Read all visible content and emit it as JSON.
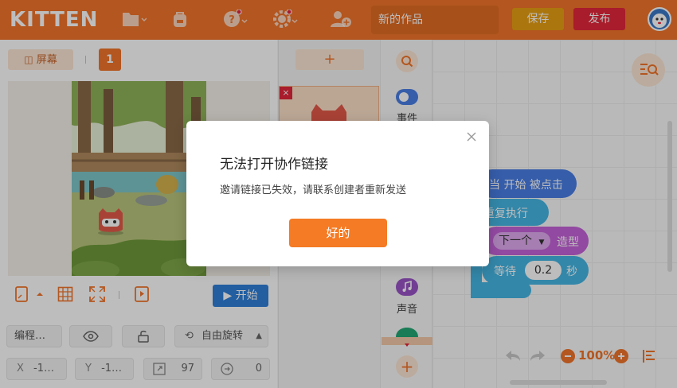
{
  "app": {
    "logo": "KITTEN"
  },
  "toolbar": {
    "file_icon": "folder-icon",
    "backpack_icon": "backpack-icon",
    "help_icon": "help-icon",
    "settings_icon": "gear-icon",
    "collab_icon": "add-user-icon",
    "title_placeholder": "新的作品",
    "save_label": "保存",
    "publish_label": "发布",
    "accent": "#f2752a",
    "save_color": "#e8a013",
    "publish_color": "#e5263a"
  },
  "stage": {
    "screen_label": "屏幕",
    "page_number": "1",
    "start_label": "开始",
    "start_color": "#2f7fd8"
  },
  "properties": {
    "name": "编程…",
    "rotation_mode": "自由旋转",
    "x_label": "X",
    "x_value": "-1…",
    "y_label": "Y",
    "y_value": "-1…",
    "size_value": "97",
    "direction_value": "0"
  },
  "sprites": {
    "add_label": "+",
    "delete_label": "×"
  },
  "categories": {
    "items": [
      {
        "label": "事件",
        "color": "#4a7ee5",
        "icon": "toggle-icon"
      },
      {
        "label": "声音",
        "color": "#9a54c8",
        "icon": "music-note-icon"
      }
    ],
    "add_label": "+"
  },
  "workspace": {
    "event_block": "当 开始 被点击",
    "loop_block": "重复执行",
    "costume_dropdown": "下一个",
    "costume_label": "造型",
    "wait_label": "等待",
    "wait_value": "0.2",
    "wait_unit": "秒",
    "zoom": "100%"
  },
  "dialog": {
    "title": "无法打开协作链接",
    "message": "邀请链接已失效，请联系创建者重新发送",
    "ok_label": "好的",
    "ok_color": "#f57b24"
  }
}
